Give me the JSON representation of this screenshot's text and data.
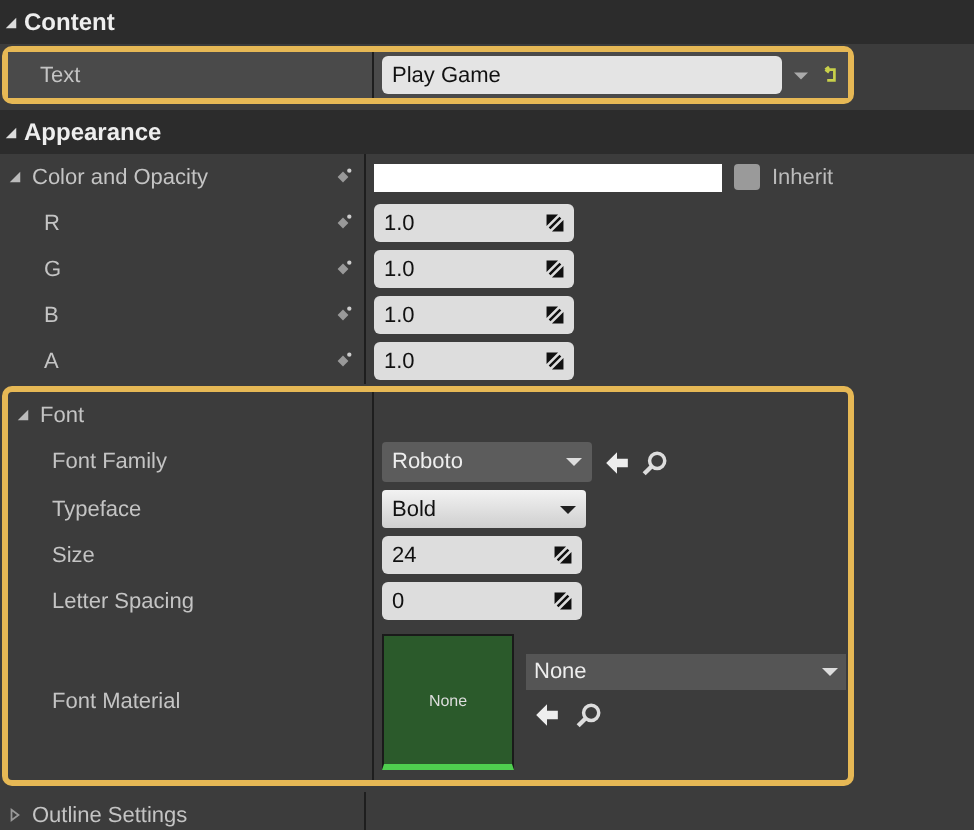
{
  "groups": [
    {
      "title": "Content",
      "expanded": true,
      "rows": [
        {
          "kind": "text",
          "label": "Text",
          "value": "Play Game",
          "highlighted": true
        }
      ]
    },
    {
      "title": "Appearance",
      "expanded": true,
      "rows": [
        {
          "kind": "color",
          "label": "Color and Opacity",
          "expanded": true,
          "binding": true,
          "inherit": {
            "label": "Inherit",
            "checked": false
          },
          "children": [
            {
              "kind": "number",
              "label": "R",
              "value": "1.0",
              "binding": true
            },
            {
              "kind": "number",
              "label": "G",
              "value": "1.0",
              "binding": true
            },
            {
              "kind": "number",
              "label": "B",
              "value": "1.0",
              "binding": true
            },
            {
              "kind": "number",
              "label": "A",
              "value": "1.0",
              "binding": true
            }
          ]
        },
        {
          "kind": "category",
          "label": "Font",
          "expanded": true,
          "highlighted": true,
          "children": [
            {
              "kind": "asset",
              "label": "Font Family",
              "value": "Roboto"
            },
            {
              "kind": "dropdown",
              "label": "Typeface",
              "value": "Bold"
            },
            {
              "kind": "number",
              "label": "Size",
              "value": "24"
            },
            {
              "kind": "number",
              "label": "Letter Spacing",
              "value": "0"
            },
            {
              "kind": "material",
              "label": "Font Material",
              "thumb": "None",
              "value": "None"
            }
          ]
        },
        {
          "kind": "category",
          "label": "Outline Settings",
          "expanded": false
        }
      ]
    }
  ]
}
